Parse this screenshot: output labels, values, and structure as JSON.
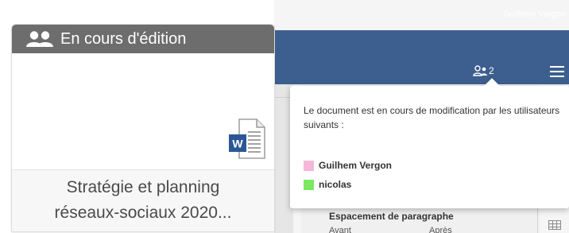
{
  "card": {
    "status_label": "En cours d'édition",
    "status_icon": "users-icon",
    "file_icon": "word-icon",
    "title_line1": "Stratégie et planning",
    "title_line2": "réseaux-sociaux 2020..."
  },
  "editor": {
    "current_user": "Guilhem Vergon",
    "users_count": "2",
    "users_icon": "users-icon",
    "menu_icon": "hamburger-icon",
    "panel": {
      "heading": "Espacement de paragraphe",
      "before_label": "Avant",
      "after_label": "Après"
    }
  },
  "popup": {
    "message": "Le document est en cours de modification par les utilisateurs suivants :",
    "users": [
      {
        "name": "Guilhem Vergon",
        "color": "#f5b8d8"
      },
      {
        "name": "nicolas",
        "color": "#7ae862"
      }
    ]
  },
  "colors": {
    "header_bar": "#3d5f8f",
    "card_header": "#6d6d6d",
    "word_blue": "#2b5797"
  }
}
